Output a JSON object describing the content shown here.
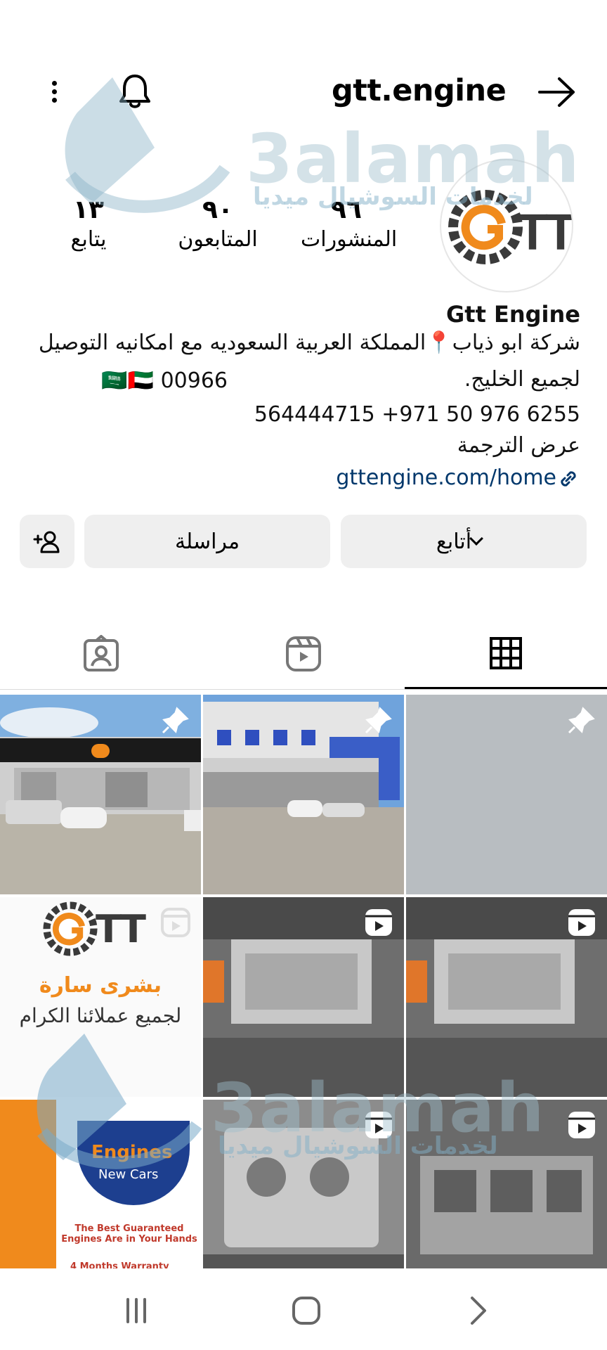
{
  "header": {
    "username": "gtt.engine"
  },
  "stats": {
    "posts": {
      "value": "٩٦",
      "label": "المنشورات"
    },
    "followers": {
      "value": "٩٠",
      "label": "المتابعون"
    },
    "following": {
      "value": "١٣",
      "label": "يتابع"
    }
  },
  "profile": {
    "name": "Gtt Engine",
    "bio_line1": "شركة ابو ذياب📍المملكة العربية السعوديه مع امكانيه التوصيل",
    "bio_line2": "لجميع الخليج.",
    "phone_prefix": "00966",
    "flags": "🇸🇦🇦🇪",
    "phones": "564444715 +971 50 976 6255",
    "see_translation": "عرض الترجمة",
    "link": "gttengine.com/home"
  },
  "avatar": {
    "logo_text": "TT"
  },
  "watermark": {
    "brand": "3alamah",
    "tagline": "لخدمات السوشيال ميديا"
  },
  "actions": {
    "follow_label": "أتابع",
    "message_label": "مراسلة"
  },
  "tabs": [
    {
      "icon": "grid-icon",
      "active": true
    },
    {
      "icon": "reels-icon",
      "active": false
    },
    {
      "icon": "tagged-icon",
      "active": false
    }
  ],
  "posts": [
    {
      "type": "pinned",
      "desc": "storefront"
    },
    {
      "type": "pinned",
      "desc": "building"
    },
    {
      "type": "pinned",
      "desc": "blank"
    },
    {
      "type": "reel",
      "title": "بشرى سارة",
      "subtitle": "لجميع عملائنا الكرام",
      "logo": "TT"
    },
    {
      "type": "reel",
      "desc": "engine factory"
    },
    {
      "type": "reel",
      "desc": "engine factory"
    },
    {
      "type": "image",
      "title": "Engines",
      "subtitle": "New Cars",
      "caption_en": "The Best Guaranteed Engines Are in Your Hands",
      "warranty": "4 Months Warranty"
    },
    {
      "type": "reel",
      "desc": "engine block"
    },
    {
      "type": "reel",
      "desc": "engine line"
    }
  ],
  "colors": {
    "accent_orange": "#f08a1c",
    "logo_gray": "#3a3a3a",
    "link_blue": "#00376b",
    "button_bg": "#efefef"
  }
}
